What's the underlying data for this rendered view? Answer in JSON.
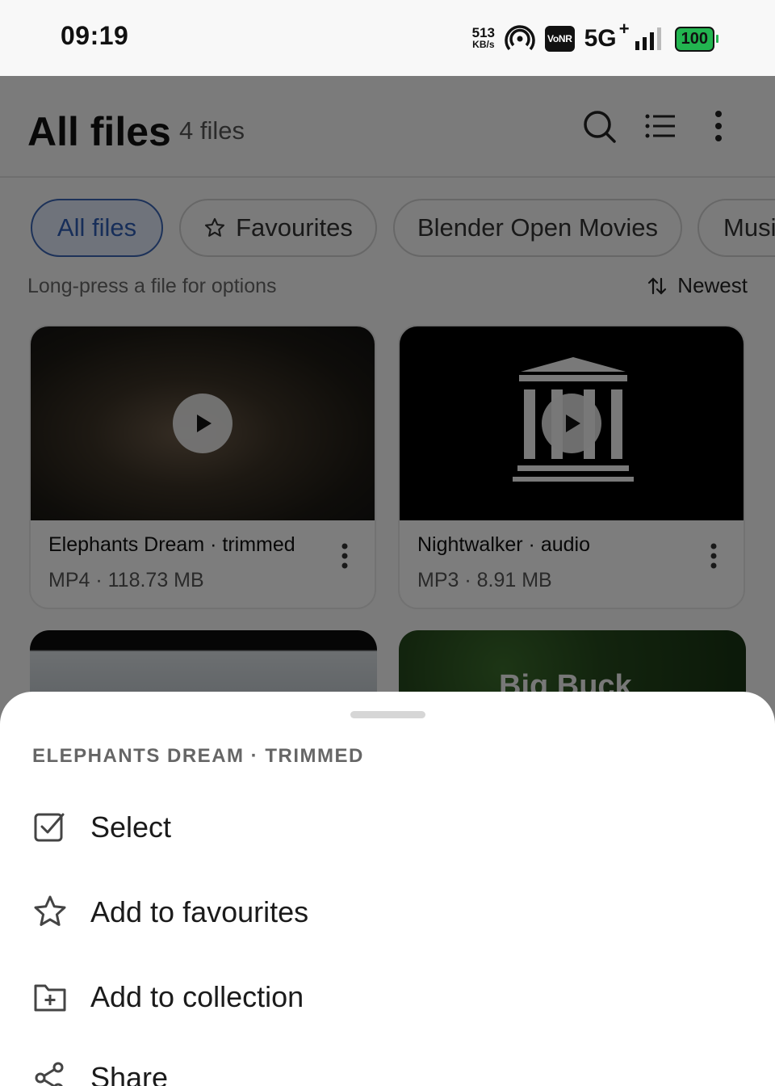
{
  "status_bar": {
    "time": "09:19",
    "net_speed_value": "513",
    "net_speed_unit": "KB/s",
    "vonr": "VoNR",
    "network": "5G",
    "network_plus": "+",
    "battery": "100"
  },
  "header": {
    "title": "All files",
    "count": "4 files",
    "icons": [
      "search-icon",
      "list-view-icon",
      "more-vert-icon"
    ]
  },
  "chips": [
    {
      "label": "All files",
      "active": true
    },
    {
      "label": "Favourites",
      "icon": "star-icon"
    },
    {
      "label": "Blender Open Movies"
    },
    {
      "label": "Musi"
    }
  ],
  "hint": "Long-press a file for options",
  "sort": {
    "label": "Newest",
    "icon": "sort-icon"
  },
  "files": [
    {
      "title": "Elephants Dream · trimmed",
      "meta": "MP4 · 118.73 MB"
    },
    {
      "title": "Nightwalker · audio",
      "meta": "MP3 · 8.91 MB"
    }
  ],
  "partial_thumb_text": "Big Buck",
  "sheet": {
    "title": "ELEPHANTS DREAM · TRIMMED",
    "actions": [
      {
        "label": "Select",
        "icon": "checkbox-icon"
      },
      {
        "label": "Add to favourites",
        "icon": "star-icon"
      },
      {
        "label": "Add to collection",
        "icon": "folder-add-icon"
      },
      {
        "label": "Share",
        "icon": "share-icon"
      }
    ]
  },
  "colors": {
    "accent": "#3b65b3",
    "chip_active_bg": "#dfe7f7",
    "battery": "#22b550",
    "scrim": "rgba(0,0,0,0.5)"
  }
}
